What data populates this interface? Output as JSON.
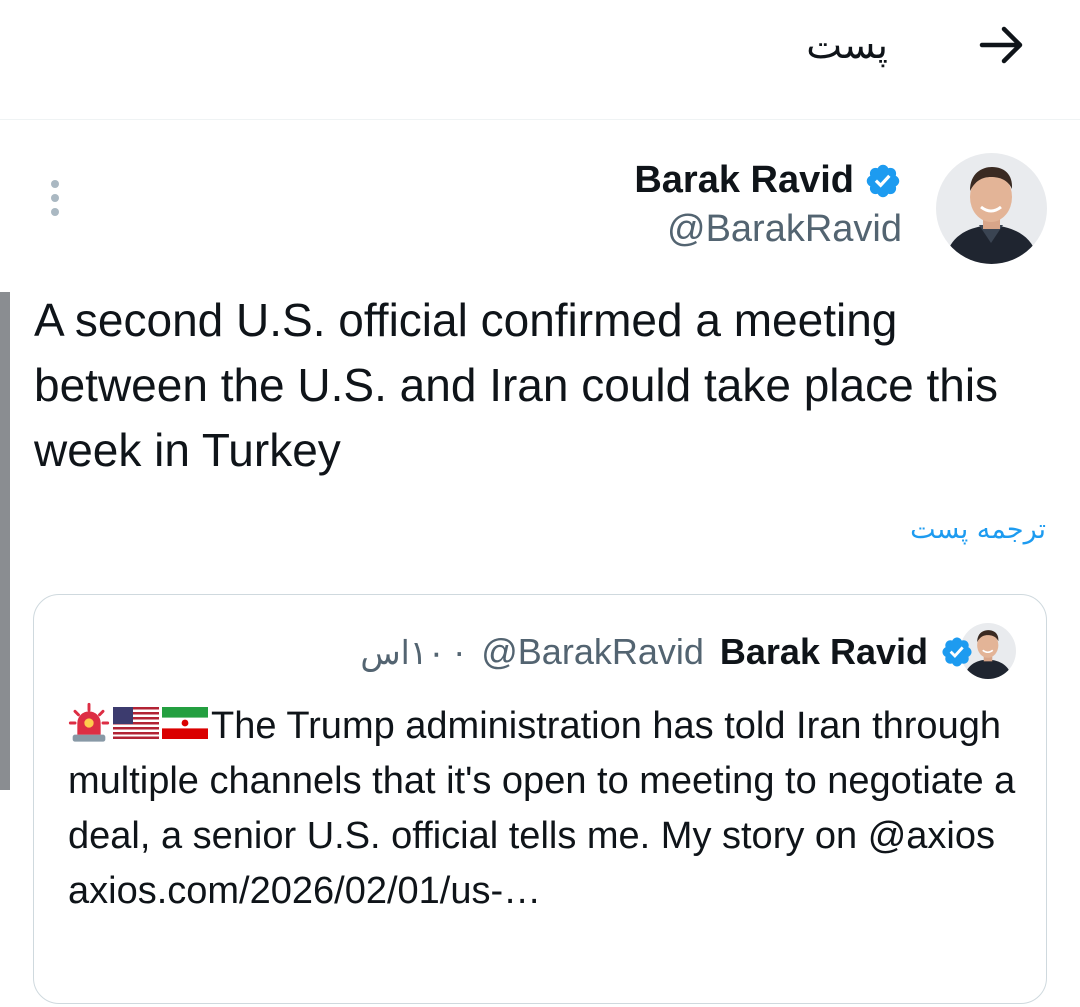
{
  "header": {
    "title": "پست",
    "back_icon": "arrow-right-icon"
  },
  "tweet": {
    "author_name": "Barak Ravid",
    "author_handle": "@BarakRavid",
    "verified": true,
    "text": "A second U.S. official confirmed a meeting between the U.S. and Iran could take place this week in Turkey",
    "translate_label": "ترجمه پست",
    "more_icon": "more-vertical-icon"
  },
  "quoted_tweet": {
    "author_name": "Barak Ravid",
    "author_handle": "@BarakRavid",
    "separator": "·",
    "time": "۱۰اس",
    "verified": true,
    "emojis": [
      "police-light-emoji",
      "us-flag-emoji",
      "iran-flag-emoji"
    ],
    "text": "The Trump administration has told Iran through multiple channels that it's open to meeting to negotiate a deal, a senior U.S. official tells me. My story on @axios axios.com/2026/02/01/us-…"
  },
  "colors": {
    "accent": "#1d9bf0",
    "text_primary": "#0f1419",
    "text_secondary": "#536471",
    "border": "#cfd9de"
  }
}
